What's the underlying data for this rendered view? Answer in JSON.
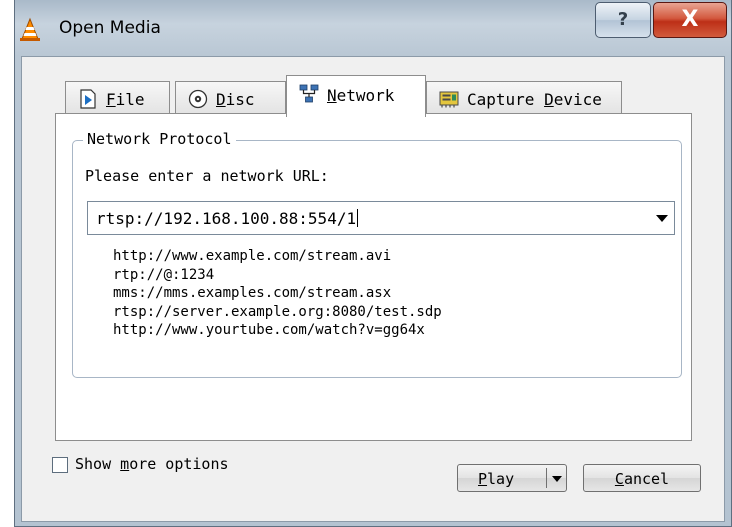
{
  "window": {
    "title": "Open Media"
  },
  "titlebar": {
    "help_label": "?",
    "close_label": "X"
  },
  "tabs": [
    {
      "pre": "",
      "mnemonic": "F",
      "post": "ile",
      "icon": "file-play-icon",
      "active": false
    },
    {
      "pre": "",
      "mnemonic": "D",
      "post": "isc",
      "icon": "disc-icon",
      "active": false
    },
    {
      "pre": "",
      "mnemonic": "N",
      "post": "etwork",
      "icon": "network-icon",
      "active": true
    },
    {
      "pre": "Capture ",
      "mnemonic": "D",
      "post": "evice",
      "icon": "capture-card-icon",
      "active": false
    }
  ],
  "network": {
    "group_title": "Network Protocol",
    "prompt": "Please enter a network URL:",
    "url_value": "rtsp://192.168.100.88:554/1",
    "examples": [
      "http://www.example.com/stream.avi",
      "rtp://@:1234",
      "mms://mms.examples.com/stream.asx",
      "rtsp://server.example.org:8080/test.sdp",
      "http://www.yourtube.com/watch?v=gg64x"
    ]
  },
  "footer": {
    "more_options": {
      "pre": "Show ",
      "mnemonic": "m",
      "post": "ore options",
      "checked": false
    },
    "play": {
      "mnemonic": "P",
      "post": "lay"
    },
    "cancel": {
      "mnemonic": "C",
      "post": "ancel"
    }
  },
  "colors": {
    "title_bar": "#b9c7d4",
    "close_button": "#c8452c",
    "dialog_bg": "#f0f0f0"
  }
}
